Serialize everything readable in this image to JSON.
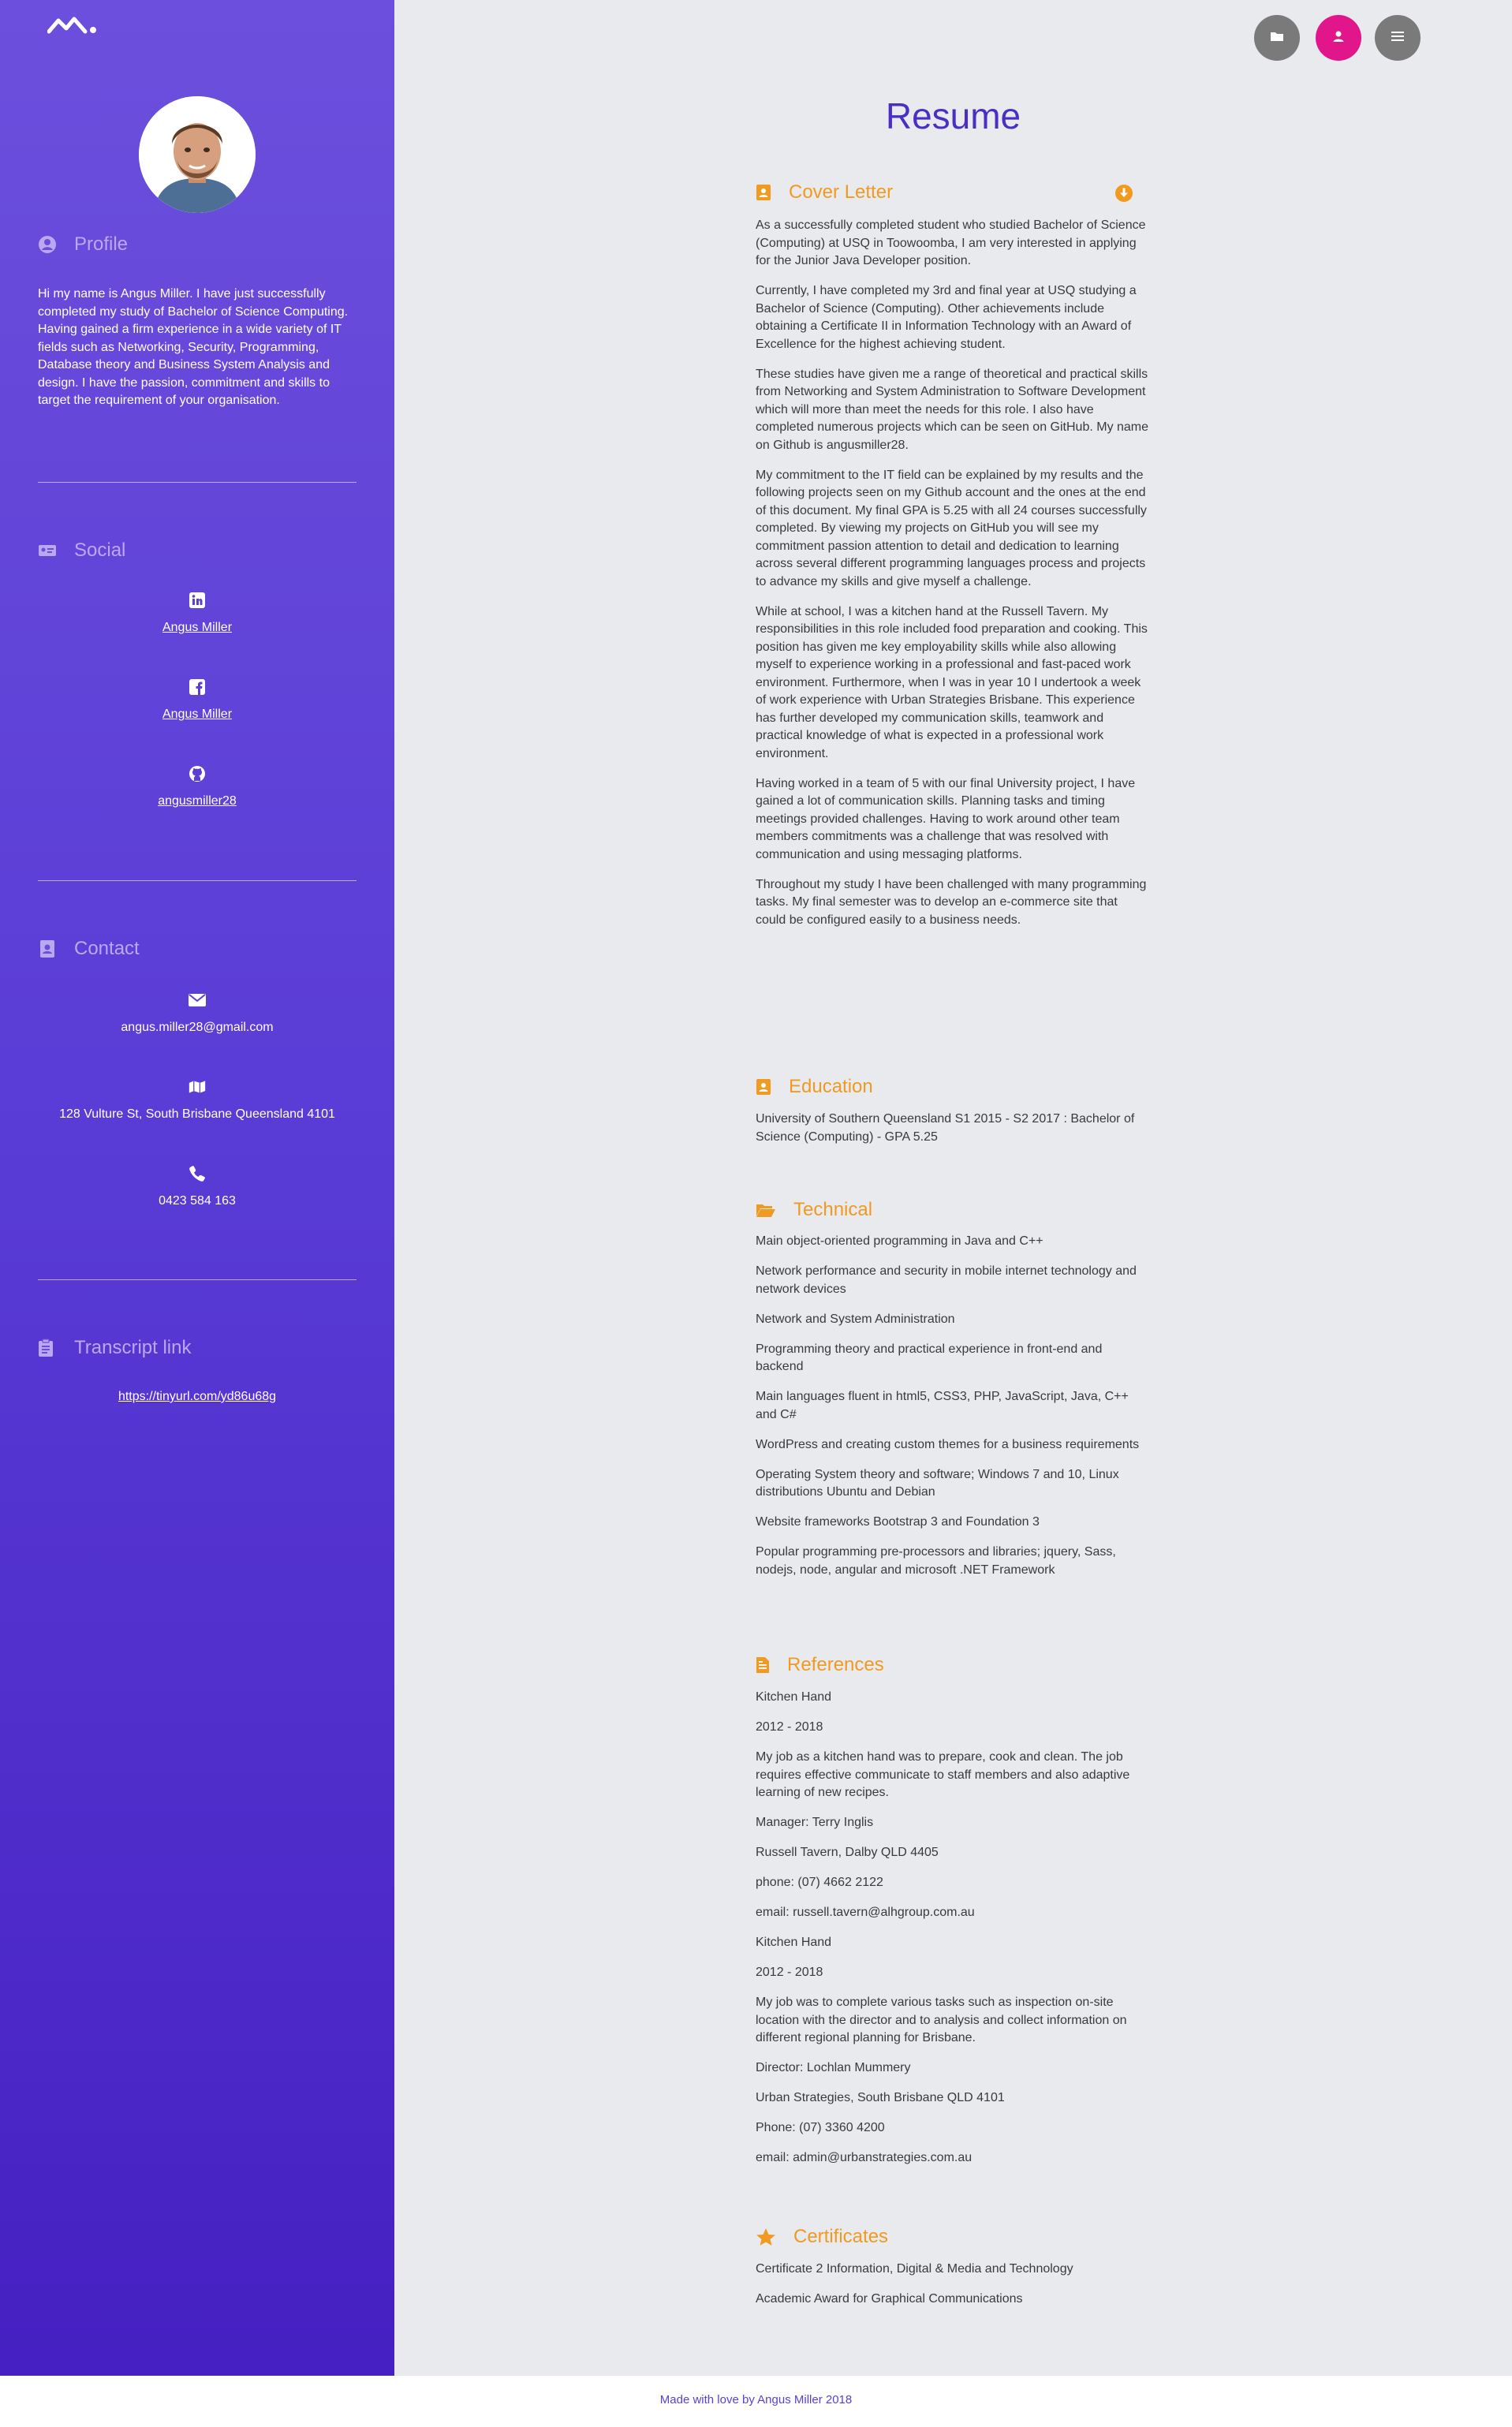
{
  "sidebar": {
    "profile": {
      "heading": "Profile",
      "text": "Hi my name is Angus Miller. I have just successfully completed my study of Bachelor of Science Computing. Having gained a firm experience in a wide variety of IT fields such as Networking, Security, Programming, Database theory and Business System Analysis and design. I have the passion, commitment and skills to target the requirement of your organisation."
    },
    "social": {
      "heading": "Social",
      "items": [
        {
          "icon": "linkedin-icon",
          "label": "Angus Miller"
        },
        {
          "icon": "facebook-icon",
          "label": "Angus Miller"
        },
        {
          "icon": "github-icon",
          "label": "angusmiller28"
        }
      ]
    },
    "contact": {
      "heading": "Contact",
      "items": [
        {
          "icon": "envelope-icon",
          "label": "angus.miller28@gmail.com"
        },
        {
          "icon": "map-icon",
          "label": "128 Vulture St, South Brisbane Queensland 4101"
        },
        {
          "icon": "phone-icon",
          "label": "0423 584 163"
        }
      ]
    },
    "transcript": {
      "heading": "Transcript link",
      "link": "https://tinyurl.com/yd86u68g"
    }
  },
  "topbar": {
    "buttons": [
      {
        "icon": "folder-icon",
        "color": "#7a7a7a"
      },
      {
        "icon": "user-icon",
        "color": "#e0168a"
      },
      {
        "icon": "menu-icon",
        "color": "#7a7a7a"
      }
    ]
  },
  "main": {
    "title": "Resume",
    "cover_letter": {
      "heading": "Cover Letter",
      "paragraphs": [
        "As a successfully completed student who studied Bachelor of Science (Computing) at USQ in Toowoomba, I am very interested in applying for the Junior Java Developer position.",
        "Currently, I have completed my 3rd and final year at USQ studying a Bachelor of Science (Computing). Other achievements include obtaining a Certificate II in Information Technology with an Award of Excellence for the highest achieving student.",
        "These studies have given me a range of theoretical and practical skills from Networking and System Administration to Software Development which will more than meet the needs for this role. I also have completed numerous projects which can be seen on GitHub. My name on Github is angusmiller28.",
        "My commitment to the IT field can be explained by my results and the following projects seen on my Github account and the ones at the end of this document. My final GPA is 5.25 with all 24 courses successfully completed. By viewing my projects on GitHub you will see my commitment passion attention to detail and dedication to learning across several different programming languages process and projects to advance my skills and give myself a challenge.",
        "While at school, I was a kitchen hand at the Russell Tavern. My responsibilities in this role included food preparation and cooking. This position has given me key employability skills while also allowing myself to experience working in a professional and fast-paced work environment. Furthermore, when I was in year 10 I undertook a week of work experience with Urban Strategies Brisbane. This experience has further developed my communication skills, teamwork and practical knowledge of what is expected in a professional work environment.",
        "Having worked in a team of 5 with our final University project, I have gained a lot of communication skills. Planning tasks and timing meetings provided challenges. Having to work around other team members commitments was a challenge that was resolved with communication and using messaging platforms.",
        "Throughout my study I have been challenged with many programming tasks. My final semester was to develop an e-commerce site that could be configured easily to a business needs."
      ]
    },
    "education": {
      "heading": "Education",
      "text": "University of Southern Queensland S1 2015 - S2 2017 : Bachelor of Science (Computing) - GPA 5.25"
    },
    "technical": {
      "heading": "Technical",
      "items": [
        "Main object-oriented programming in Java and C++",
        "Network performance and security in mobile internet technology and network devices",
        "Network and System Administration",
        "Programming theory and practical experience in front-end and backend",
        "Main languages fluent in html5, CSS3, PHP, JavaScript, Java, C++ and C#",
        "WordPress and creating custom themes for a business requirements",
        "Operating System theory and software; Windows 7 and 10, Linux distributions Ubuntu and Debian",
        "Website frameworks Bootstrap 3 and Foundation 3",
        "Popular programming pre-processors and libraries; jquery, Sass, nodejs, node, angular and microsoft .NET Framework"
      ]
    },
    "references": {
      "heading": "References",
      "entries": [
        "Kitchen Hand",
        "2012 - 2018",
        "My job as a kitchen hand was to prepare, cook and clean. The job requires effective communicate to staff members and also adaptive learning of new recipes.",
        "Manager: Terry Inglis",
        "Russell Tavern, Dalby QLD 4405",
        "phone: (07) 4662 2122",
        "email: russell.tavern@alhgroup.com.au",
        "Kitchen Hand",
        "2012 - 2018",
        "My job was to complete various tasks such as inspection on-site location with the director and to analysis and collect information on different regional planning for Brisbane.",
        "Director: Lochlan Mummery",
        "Urban Strategies, South Brisbane QLD 4101",
        "Phone: (07) 3360 4200",
        "email: admin@urbanstrategies.com.au"
      ]
    },
    "certificates": {
      "heading": "Certificates",
      "items": [
        "Certificate 2 Information, Digital & Media and Technology",
        "Academic Award for Graphical Communications"
      ]
    }
  },
  "footer": {
    "text": "Made with love by Angus Miller 2018"
  },
  "colors": {
    "sidebar_top": "#6c4fdc",
    "sidebar_bottom": "#4620c2",
    "title": "#4b2fc5",
    "section_heading": "#f19a22",
    "accent_pink": "#e0168a",
    "button_grey": "#7a7a7a",
    "page_bg": "#e8eaee"
  }
}
